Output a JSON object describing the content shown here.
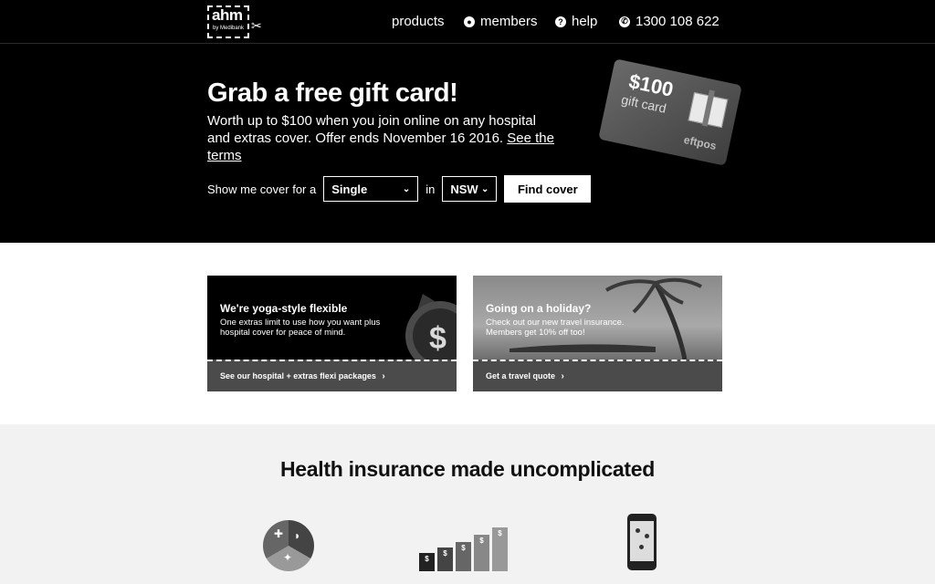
{
  "header": {
    "logo": {
      "brand": "ahm",
      "sub": "by Medibank",
      "icon": "scissors-icon"
    },
    "nav": [
      {
        "label": "products",
        "icon": ""
      },
      {
        "label": "members",
        "icon": "user-icon"
      },
      {
        "label": "help",
        "icon": "question-icon"
      },
      {
        "label": "1300 108 622",
        "icon": "phone-icon"
      }
    ]
  },
  "hero": {
    "title": "Grab a free gift card!",
    "text": "Worth up to $100 when you join online on any hospital and extras cover. Offer ends November 16 2016.",
    "terms_link": "See the terms",
    "form": {
      "prefix": "Show me cover for a",
      "cover_type": "Single",
      "in_label": "in",
      "state": "NSW",
      "button": "Find cover"
    },
    "gift_card": {
      "amount": "$100",
      "label": "gift card",
      "brand": "eftpos"
    }
  },
  "promos": [
    {
      "title": "We're yoga-style flexible",
      "body": "One extras limit to use how you want plus hospital cover for peace of mind.",
      "link": "See our hospital + extras flexi packages"
    },
    {
      "title": "Going on a holiday?",
      "body": "Check out our new travel insurance. Members get 10% off too!",
      "link": "Get a travel quote"
    }
  ],
  "section": {
    "title": "Health insurance made uncomplicated",
    "bars": [
      "$",
      "$",
      "$",
      "$",
      "$"
    ]
  },
  "colors": {
    "background": "#000000",
    "section_bg": "#f2f2f2",
    "accent": "#ffffff"
  }
}
